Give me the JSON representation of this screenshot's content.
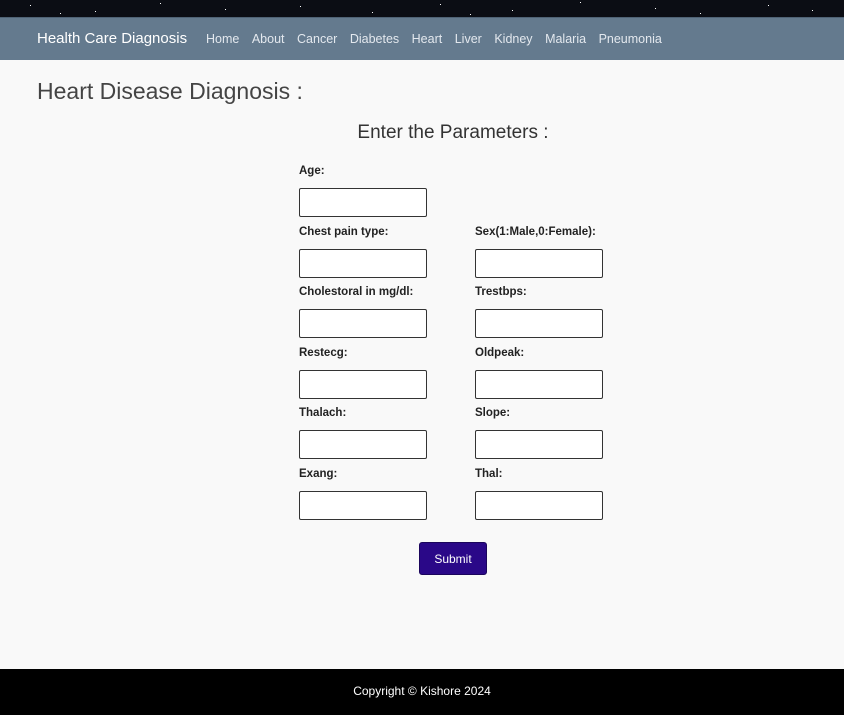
{
  "navbar": {
    "brand": "Health Care Diagnosis",
    "links": [
      "Home",
      "About",
      "Cancer",
      "Diabetes",
      "Heart",
      "Liver",
      "Kidney",
      "Malaria",
      "Pneumonia"
    ]
  },
  "page": {
    "title": "Heart Disease Diagnosis :",
    "form_heading": "Enter the Parameters :"
  },
  "form": {
    "fields": [
      {
        "label": "Age:",
        "value": ""
      },
      {
        "label": "Chest pain type:",
        "value": ""
      },
      {
        "label": "Sex(1:Male,0:Female):",
        "value": ""
      },
      {
        "label": "Cholestoral in mg/dl:",
        "value": ""
      },
      {
        "label": "Trestbps:",
        "value": ""
      },
      {
        "label": "Restecg:",
        "value": ""
      },
      {
        "label": "Oldpeak:",
        "value": ""
      },
      {
        "label": "Thalach:",
        "value": ""
      },
      {
        "label": "Slope:",
        "value": ""
      },
      {
        "label": "Exang:",
        "value": ""
      },
      {
        "label": "Thal:",
        "value": ""
      }
    ],
    "submit_label": "Submit"
  },
  "footer": {
    "text": "Copyright © Kishore 2024"
  },
  "colors": {
    "navbar": "#647a8e",
    "submit_button": "#2a0888",
    "footer": "#000000",
    "page_background": "#f9f9f9"
  }
}
